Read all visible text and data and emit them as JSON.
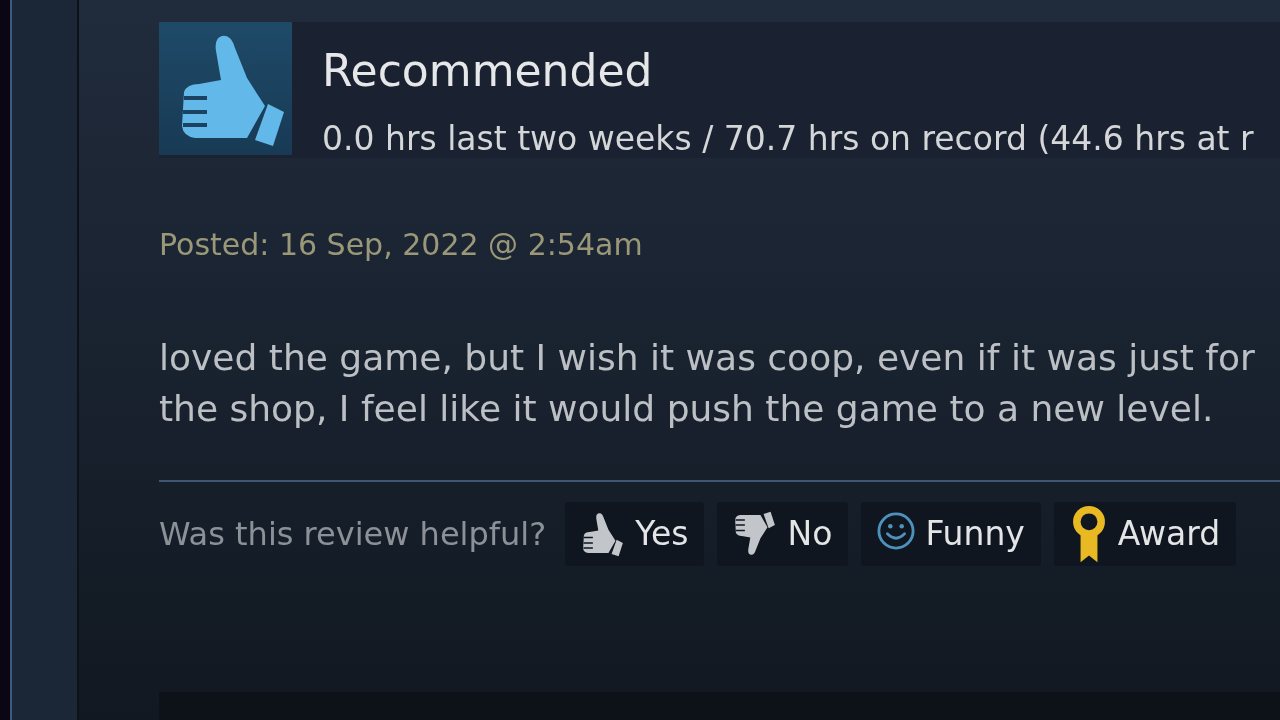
{
  "review": {
    "verdict": {
      "title": "Recommended",
      "kind": "positive"
    },
    "hours": "0.0 hrs last two weeks / 70.7 hrs on record (44.6 hrs at r",
    "posted": "Posted: 16 Sep, 2022 @ 2:54am",
    "body_lines": [
      "loved the game, but I wish it was coop, even if it was just for",
      "the shop, I feel like it would push the game to a new level."
    ],
    "helpful": {
      "prompt": "Was this review helpful?",
      "buttons": [
        {
          "label": "Yes",
          "kind": "yes"
        },
        {
          "label": "No",
          "kind": "no"
        },
        {
          "label": "Funny",
          "kind": "funny"
        },
        {
          "label": "Award",
          "kind": "award"
        }
      ]
    }
  }
}
